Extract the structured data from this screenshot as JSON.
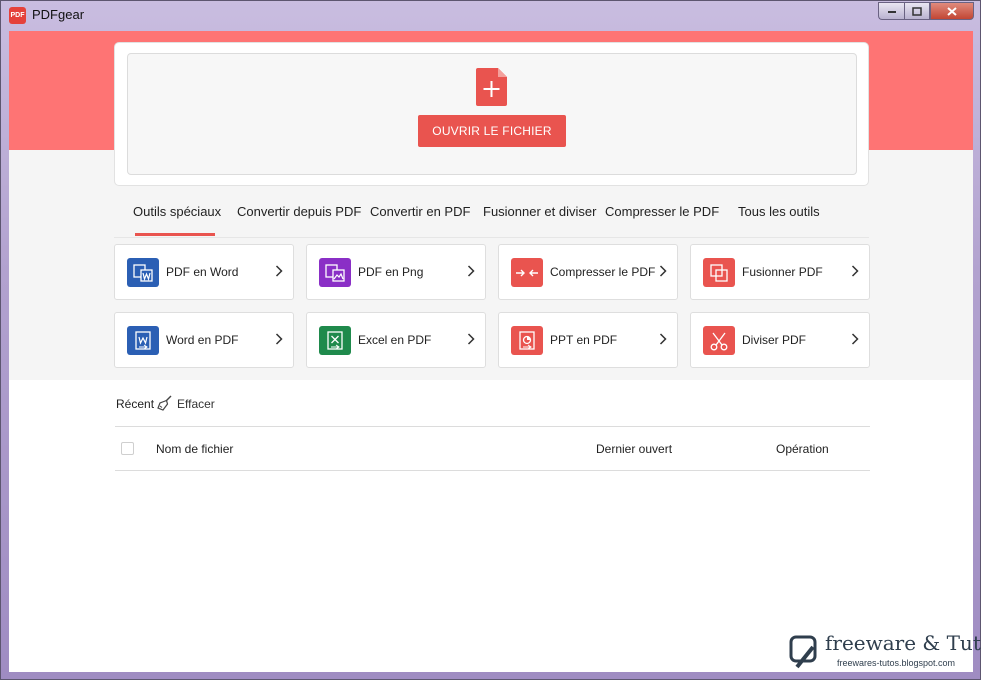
{
  "window": {
    "title": "PDFgear",
    "logo_text": "PDF"
  },
  "colors": {
    "accent": "#e9544f",
    "hero": "#fe7474",
    "word_blue": "#2b5fb4",
    "png_purple": "#8a2fc6",
    "excel_green": "#1f8a4c",
    "red": "#e9544f"
  },
  "open": {
    "button_label": "OUVRIR LE FICHIER"
  },
  "tabs": [
    {
      "label": "Outils spéciaux"
    },
    {
      "label": "Convertir depuis PDF"
    },
    {
      "label": "Convertir en PDF"
    },
    {
      "label": "Fusionner et diviser"
    },
    {
      "label": "Compresser le PDF"
    },
    {
      "label": "Tous les outils"
    }
  ],
  "tools": [
    {
      "label": "PDF en Word",
      "icon": "word-doc-icon"
    },
    {
      "label": "PDF en Png",
      "icon": "image-icon"
    },
    {
      "label": "Compresser le PDF",
      "icon": "compress-icon"
    },
    {
      "label": "Fusionner PDF",
      "icon": "merge-icon"
    },
    {
      "label": "Word en PDF",
      "icon": "word-to-pdf-icon"
    },
    {
      "label": "Excel en PDF",
      "icon": "excel-icon"
    },
    {
      "label": "PPT en PDF",
      "icon": "ppt-icon"
    },
    {
      "label": "Diviser PDF",
      "icon": "scissors-icon"
    }
  ],
  "recent": {
    "label": "Récent",
    "clear_label": "Effacer"
  },
  "table": {
    "columns": [
      "Nom de fichier",
      "Dernier ouvert",
      "Opération"
    ]
  },
  "watermark": {
    "title": "freeware & Tutos",
    "url": "freewares-tutos.blogspot.com"
  }
}
